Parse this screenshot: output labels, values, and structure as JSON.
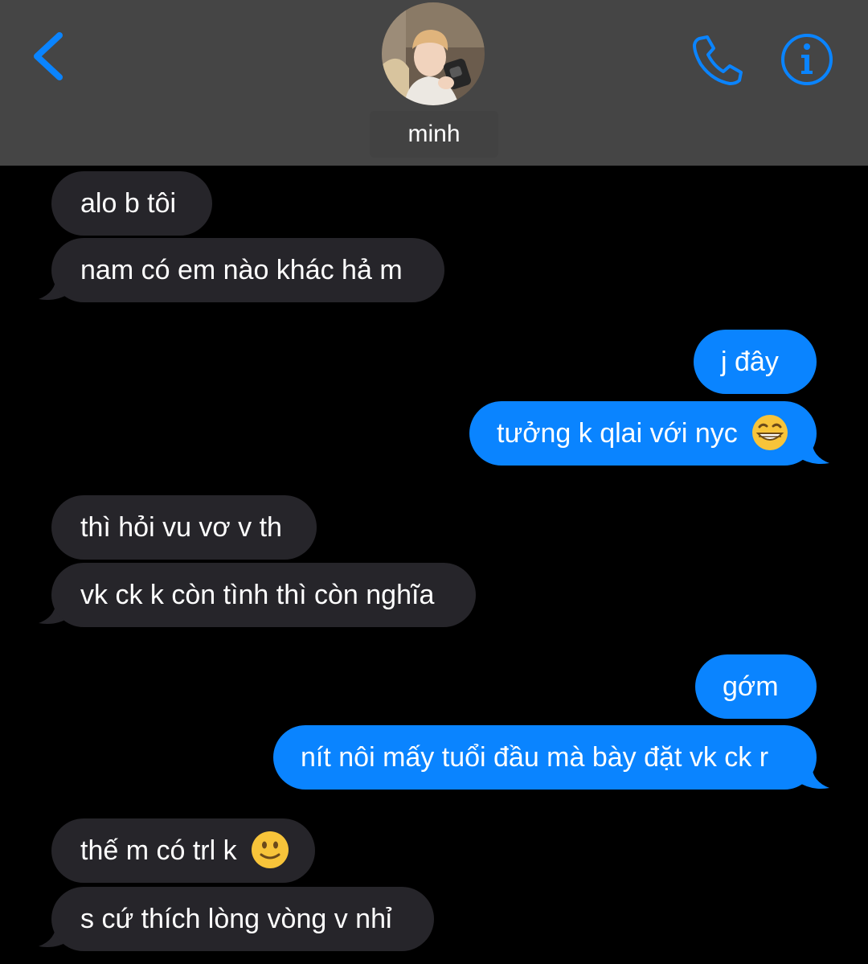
{
  "header": {
    "contact_name": "minh",
    "back_icon": "chevron-left-icon",
    "call_icon": "phone-icon",
    "info_icon": "info-icon",
    "accent_color": "#0a84ff"
  },
  "messages": [
    {
      "direction": "incoming",
      "text": "alo b tôi"
    },
    {
      "direction": "incoming",
      "text": "nam có em nào khác hả m"
    },
    {
      "direction": "outgoing",
      "text": "j đây"
    },
    {
      "direction": "outgoing",
      "text": "tưởng k qlai với nyc",
      "emoji": "grinning-face"
    },
    {
      "direction": "incoming",
      "text": "thì hỏi vu vơ v th"
    },
    {
      "direction": "incoming",
      "text": "vk ck k còn tình thì còn nghĩa"
    },
    {
      "direction": "outgoing",
      "text": "gớm"
    },
    {
      "direction": "outgoing",
      "text": "nít nôi mấy tuổi đầu mà bày đặt vk ck r"
    },
    {
      "direction": "incoming",
      "text": "thế m có trl k",
      "emoji": "slightly-smiling-face"
    },
    {
      "direction": "incoming",
      "text": "s cứ thích lòng vòng v nhỉ"
    }
  ],
  "colors": {
    "incoming_bubble": "#26252a",
    "outgoing_bubble": "#0a84ff",
    "header_bg": "#454545",
    "background": "#000000"
  }
}
